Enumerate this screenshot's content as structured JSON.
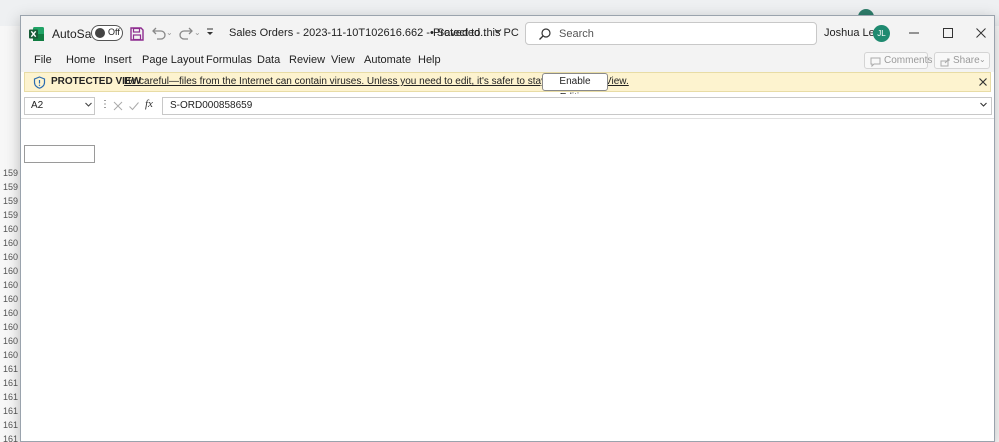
{
  "background_window": {
    "row_numbers": [
      "159",
      "159",
      "159",
      "159",
      "160",
      "160",
      "160",
      "160",
      "160",
      "160",
      "160",
      "160",
      "160",
      "160",
      "161",
      "161",
      "161",
      "161",
      "161",
      "161"
    ]
  },
  "titlebar": {
    "autosave_label": "AutoSave",
    "autosave_state": "Off",
    "document_title": "Sales Orders - 2023-11-10T102616.662  -  Protected...",
    "saved_status": "•  Saved to this PC",
    "search_placeholder": "Search",
    "user_name": "Joshua Levy",
    "user_initials": "JL"
  },
  "ribbon": {
    "tabs": [
      "File",
      "Home",
      "Insert",
      "Page Layout",
      "Formulas",
      "Data",
      "Review",
      "View",
      "Automate",
      "Help"
    ],
    "comments_label": "Comments",
    "share_label": "Share"
  },
  "protected_view": {
    "title": "PROTECTED VIEW",
    "message": "Be careful—files from the Internet can contain viruses. Unless you need to edit, it's safer to stay in Protected View.",
    "enable_button": "Enable Editing"
  },
  "formula_bar": {
    "name_box": "A2",
    "fx_label": "fx",
    "formula_value": "S-ORD000858659"
  },
  "colors": {
    "excel_green": "#1d6f42",
    "protected_bar_bg": "#fdf3cf",
    "avatar": "#1f8a70",
    "save_icon": "#8e2c8f"
  }
}
